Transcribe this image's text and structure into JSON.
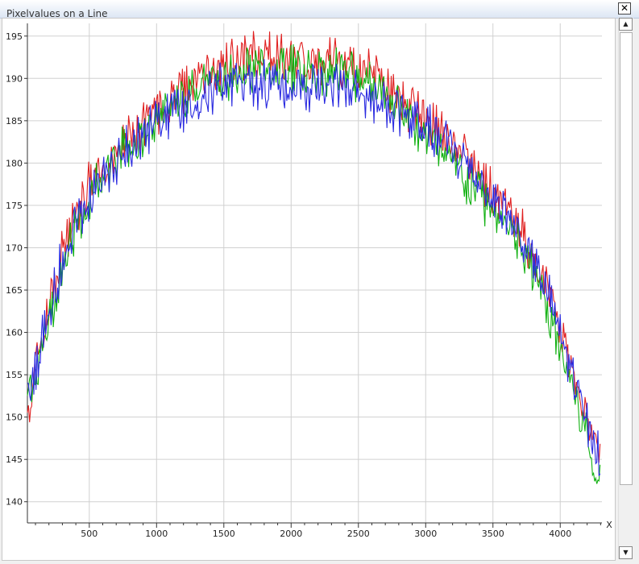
{
  "window": {
    "title": "Pixelvalues on a Line",
    "close_label": "✕"
  },
  "scrollbar": {
    "up_label": "▲",
    "down_label": "▼"
  },
  "chart_data": {
    "type": "line",
    "title": "",
    "xlabel": "X",
    "ylabel": "",
    "xlim": [
      40,
      4310
    ],
    "ylim": [
      137.5,
      196.5
    ],
    "x_ticks": [
      500,
      1000,
      1500,
      2000,
      2500,
      3000,
      3500,
      4000
    ],
    "y_ticks": [
      140,
      145,
      150,
      155,
      160,
      165,
      170,
      175,
      180,
      185,
      190,
      195
    ],
    "grid": true,
    "legend": "none",
    "series": [
      {
        "color": "#e02020",
        "x": [
          40,
          120,
          200,
          300,
          400,
          500,
          600,
          700,
          800,
          900,
          1000,
          1100,
          1200,
          1300,
          1400,
          1500,
          1600,
          1700,
          1800,
          1900,
          2000,
          2100,
          2200,
          2300,
          2400,
          2500,
          2600,
          2700,
          2800,
          2900,
          3000,
          3100,
          3200,
          3300,
          3400,
          3500,
          3600,
          3700,
          3800,
          3900,
          4000,
          4100,
          4200,
          4300
        ],
        "values": [
          151.5,
          157.5,
          163,
          169.5,
          174,
          177,
          179.5,
          181.5,
          183,
          184.5,
          186,
          187.5,
          189,
          190,
          191,
          191.5,
          192.5,
          193,
          193,
          192.5,
          192.5,
          192,
          192,
          192,
          191.5,
          190.5,
          190,
          189,
          188,
          186.5,
          185,
          183.5,
          182,
          180.5,
          178.5,
          176.5,
          174.5,
          172,
          169,
          165,
          160.5,
          155,
          149.5,
          145
        ]
      },
      {
        "color": "#10b010",
        "x": [
          40,
          120,
          200,
          300,
          400,
          500,
          600,
          700,
          800,
          900,
          1000,
          1100,
          1200,
          1300,
          1400,
          1500,
          1600,
          1700,
          1800,
          1900,
          2000,
          2100,
          2200,
          2300,
          2400,
          2500,
          2600,
          2700,
          2800,
          2900,
          3000,
          3100,
          3200,
          3300,
          3400,
          3500,
          3600,
          3700,
          3800,
          3900,
          4000,
          4100,
          4200,
          4300
        ],
        "values": [
          151,
          156,
          161,
          167.5,
          172.5,
          175.5,
          178.5,
          180.5,
          182,
          183.5,
          185,
          186.5,
          188,
          189,
          189.5,
          190,
          190.5,
          191,
          191,
          191,
          191,
          191,
          191,
          191,
          190.5,
          190,
          189.5,
          188.5,
          187,
          185,
          183,
          181.5,
          180,
          178,
          176.5,
          174.5,
          172.5,
          170,
          167,
          163,
          158.5,
          153,
          147.5,
          141
        ]
      },
      {
        "color": "#2a2ae0",
        "x": [
          40,
          120,
          200,
          300,
          400,
          500,
          600,
          700,
          800,
          900,
          1000,
          1100,
          1200,
          1300,
          1400,
          1500,
          1600,
          1700,
          1800,
          1900,
          2000,
          2100,
          2200,
          2300,
          2400,
          2500,
          2600,
          2700,
          2800,
          2900,
          3000,
          3100,
          3200,
          3300,
          3400,
          3500,
          3600,
          3700,
          3800,
          3900,
          4000,
          4100,
          4200,
          4300
        ],
        "values": [
          152,
          157,
          162.5,
          169,
          173.5,
          176,
          178.5,
          180.5,
          182,
          183.5,
          185,
          186,
          187,
          188,
          188.5,
          189,
          189.5,
          189.5,
          189.5,
          189.5,
          189,
          189,
          189,
          189,
          188.5,
          188,
          187.5,
          187,
          186,
          185,
          184,
          183,
          181.5,
          180,
          178,
          176,
          174,
          171.5,
          168.5,
          164.5,
          160,
          154.5,
          149,
          145
        ]
      }
    ]
  }
}
